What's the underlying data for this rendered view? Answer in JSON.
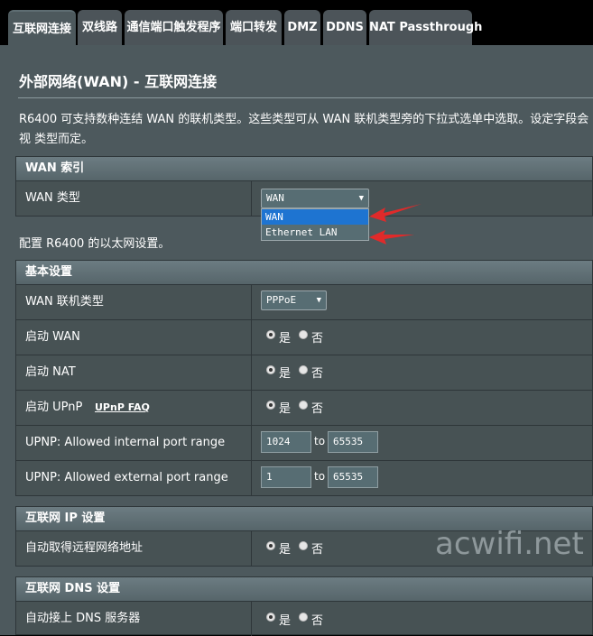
{
  "tabs": [
    {
      "label": "互联网连接",
      "active": true
    },
    {
      "label": "双线路"
    },
    {
      "label": "通信端口触发程序"
    },
    {
      "label": "端口转发"
    },
    {
      "label": "DMZ"
    },
    {
      "label": "DDNS"
    },
    {
      "label": "NAT Passthrough"
    }
  ],
  "page": {
    "title": "外部网络(WAN) - 互联网连接",
    "description": "R6400 可支持数种连结 WAN 的联机类型。这些类型可从 WAN 联机类型旁的下拉式选单中选取。设定字段会视 类型而定。"
  },
  "wan_index": {
    "header": "WAN 索引",
    "type_label": "WAN 类型",
    "type_value": "WAN",
    "dropdown_options": [
      "WAN",
      "Ethernet LAN"
    ]
  },
  "lan_note": "配置 R6400 的以太网设置。",
  "basic": {
    "header": "基本设置",
    "conn_type_label": "WAN 联机类型",
    "conn_type_value": "PPPoE",
    "enable_wan_label": "启动 WAN",
    "enable_nat_label": "启动 NAT",
    "enable_upnp_label": "启动 UPnP",
    "upnp_faq": "UPnP  FAQ",
    "internal_range_label": "UPNP: Allowed internal port range",
    "internal_from": "1024",
    "internal_to": "65535",
    "external_range_label": "UPNP: Allowed external port range",
    "external_from": "1",
    "external_to": "65535",
    "to": "to"
  },
  "yes": "是",
  "no": "否",
  "ip": {
    "header": "互联网 IP 设置",
    "auto_ip_label": "自动取得远程网络地址"
  },
  "dns": {
    "header": "互联网 DNS 设置",
    "auto_dns_label": "自动接上 DNS 服务器"
  },
  "watermark": "acwifi.net",
  "colors": {
    "accent_select": "#1e74d1",
    "arrow": "#e02a2a"
  }
}
